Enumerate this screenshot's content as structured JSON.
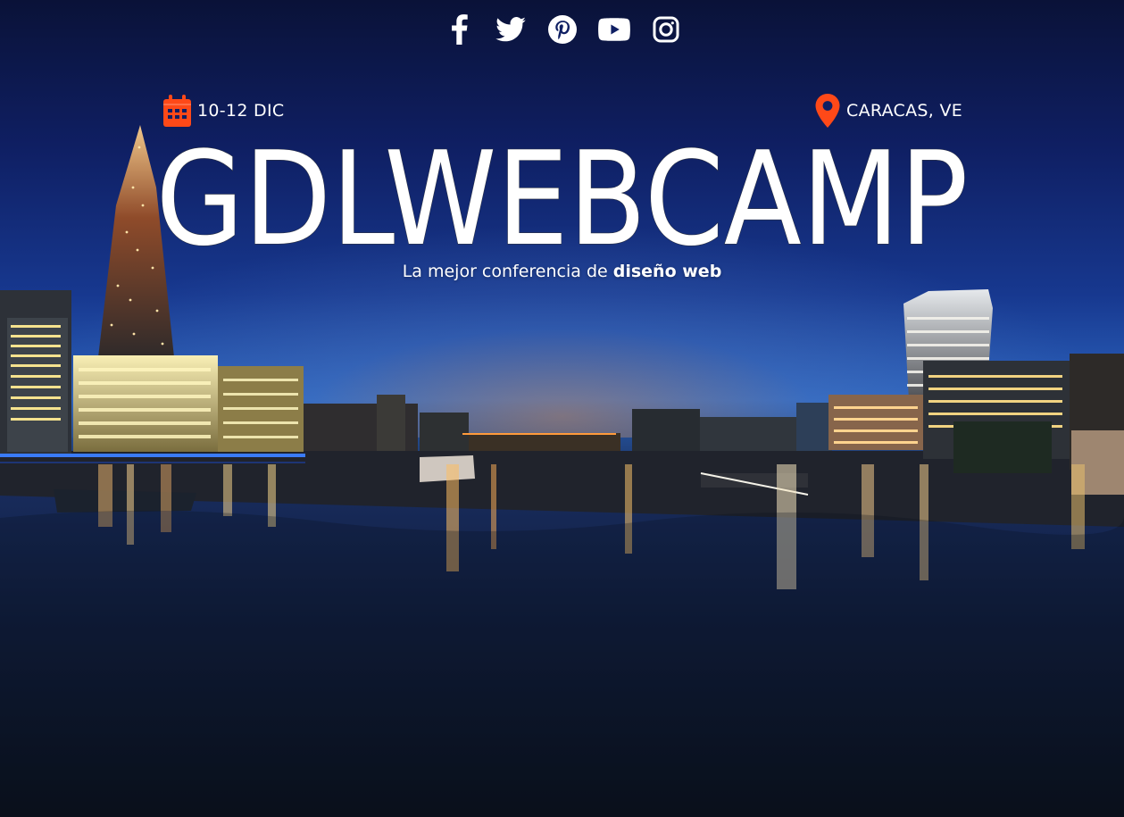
{
  "social": [
    {
      "icon": "facebook-icon"
    },
    {
      "icon": "twitter-icon"
    },
    {
      "icon": "pinterest-icon"
    },
    {
      "icon": "youtube-icon"
    },
    {
      "icon": "instagram-icon"
    }
  ],
  "event": {
    "date": "10-12 DIC",
    "location": "CARACAS, VE",
    "title": "GDLWEBCAMP",
    "subtitle_prefix": "La mejor conferencia de ",
    "subtitle_strong": "diseño web"
  },
  "colors": {
    "accent": "#fe4918",
    "text": "#ffffff"
  }
}
